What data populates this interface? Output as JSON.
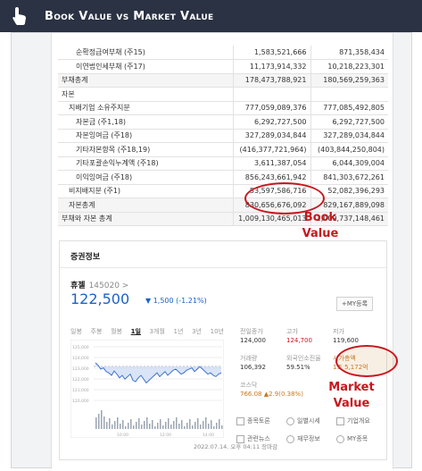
{
  "header": {
    "title": "Book Value vs Market Value",
    "icon": "hand-pointer-icon"
  },
  "table": {
    "rows": [
      {
        "label": "순확정급여부채 (주15)",
        "v1": "1,583,521,666",
        "v2": "871,358,434",
        "indent": 2,
        "hl": false
      },
      {
        "label": "이연법인세부채 (주17)",
        "v1": "11,173,914,332",
        "v2": "10,218,223,301",
        "indent": 2,
        "hl": false
      },
      {
        "label": "부채총계",
        "v1": "178,473,788,921",
        "v2": "180,569,259,363",
        "indent": 0,
        "hl": true
      },
      {
        "label": "자본",
        "v1": "",
        "v2": "",
        "indent": 0,
        "hl": false
      },
      {
        "label": "지배기업 소유주지분",
        "v1": "777,059,089,376",
        "v2": "777,085,492,805",
        "indent": 1,
        "hl": false
      },
      {
        "label": "자본금 (주1,18)",
        "v1": "6,292,727,500",
        "v2": "6,292,727,500",
        "indent": 2,
        "hl": false
      },
      {
        "label": "자본잉여금 (주18)",
        "v1": "327,289,034,844",
        "v2": "327,289,034,844",
        "indent": 2,
        "hl": false
      },
      {
        "label": "기타자본항목 (주18,19)",
        "v1": "(416,377,721,964)",
        "v2": "(403,844,250,804)",
        "indent": 2,
        "hl": false
      },
      {
        "label": "기타포괄손익누계액 (주18)",
        "v1": "3,611,387,054",
        "v2": "6,044,309,004",
        "indent": 2,
        "hl": false
      },
      {
        "label": "이익잉여금 (주18)",
        "v1": "856,243,661,942",
        "v2": "841,303,672,261",
        "indent": 2,
        "hl": false
      },
      {
        "label": "비지배지분 (주1)",
        "v1": "53,597,586,716",
        "v2": "52,082,396,293",
        "indent": 1,
        "hl": false
      },
      {
        "label": "자본총계",
        "v1": "830,656,676,092",
        "v2": "829,167,889,098",
        "indent": 1,
        "hl": true
      },
      {
        "label": "부채와 자본 총계",
        "v1": "1,009,130,465,013",
        "v2": "1,009,737,148,461",
        "indent": 0,
        "hl": true
      }
    ]
  },
  "annotations": {
    "book_value": "Book\nValue",
    "market_value": "Market\nValue",
    "color": "#c8171d"
  },
  "stock": {
    "section_title": "증권정보",
    "name": "휴젤",
    "code": "145020 >",
    "price": "122,500",
    "change": "▼ 1,500 (-1.21%)",
    "my_button": "+MY등록",
    "period_tabs": [
      "일봉",
      "주봉",
      "월봉",
      "1일",
      "3개월",
      "1년",
      "3년",
      "10년"
    ],
    "active_tab": "1일",
    "date_text": "2022.07.14. 오후 04:11 장마감",
    "market": {
      "prev_close_label": "전일종가",
      "prev_close": "124,000",
      "high_label": "고가",
      "high": "124,700",
      "low_label": "저가",
      "low": "119,600",
      "volume_label": "거래량",
      "volume": "106,392",
      "foreign_label": "외국인소진율",
      "foreign": "59.51%",
      "mcap_label": "시가총액",
      "mcap": "1조 5,172억",
      "kosdaq_label": "코스닥",
      "kosdaq": "766.08 ▲2.9(0.38%)"
    },
    "actions": [
      "종목토론",
      "일별시세",
      "기업개요",
      "관련뉴스",
      "재무정보",
      "MY종목"
    ]
  },
  "chart_data": {
    "type": "line",
    "y_ticks": [
      "125,000",
      "124,000",
      "123,000",
      "122,000",
      "121,000",
      "120,000"
    ],
    "x_ticks": [
      "10:00",
      "12:00",
      "14:00"
    ],
    "ylim": [
      119500,
      125000
    ]
  },
  "colors": {
    "title_bg": "#2a3243",
    "price_down": "#1a63c8",
    "price_up": "#d2131c"
  }
}
